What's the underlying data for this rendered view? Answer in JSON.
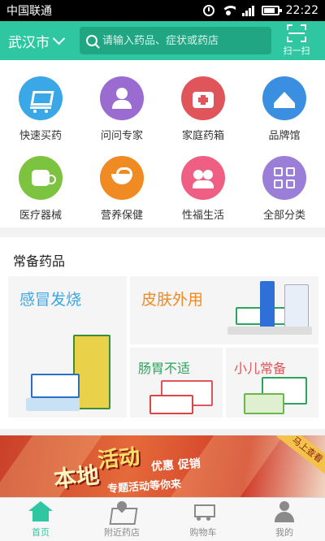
{
  "status_bar": {
    "carrier": "中国联通",
    "time": "22:22"
  },
  "header": {
    "city": "武汉市",
    "search_placeholder": "请输入药品、症状或药店",
    "scan_label": "扫一扫"
  },
  "categories": [
    {
      "label": "快速买药",
      "icon": "cart-icon",
      "color": "#3aa7e6"
    },
    {
      "label": "问问专家",
      "icon": "doctor-icon",
      "color": "#9a6cd1"
    },
    {
      "label": "家庭药箱",
      "icon": "medkit-icon",
      "color": "#e0555a"
    },
    {
      "label": "品牌馆",
      "icon": "crown-icon",
      "color": "#3a8fe0"
    },
    {
      "label": "医疗器械",
      "icon": "device-icon",
      "color": "#7cc43f"
    },
    {
      "label": "营养保健",
      "icon": "bowl-icon",
      "color": "#f08a22"
    },
    {
      "label": "性福生活",
      "icon": "couple-icon",
      "color": "#ef5f83"
    },
    {
      "label": "全部分类",
      "icon": "grid-icon",
      "color": "#9a7ed8"
    }
  ],
  "medicines": {
    "title": "常备药品",
    "tiles": [
      {
        "label": "感冒发烧",
        "color": "#3aa7e6"
      },
      {
        "label": "皮肤外用",
        "color": "#f08a22"
      },
      {
        "label": "肠胃不适",
        "color": "#2aa55a"
      },
      {
        "label": "小儿常备",
        "color": "#e0555a"
      }
    ]
  },
  "banner": {
    "word_local": "本地",
    "word_activity": "活动",
    "word_deals": "优惠  促销",
    "word_topics": "专题活动等你来",
    "corner": "马上查看"
  },
  "tabs": [
    {
      "label": "首页",
      "icon": "home-icon",
      "active": true
    },
    {
      "label": "附近药店",
      "icon": "map-icon",
      "active": false
    },
    {
      "label": "购物车",
      "icon": "cart-icon",
      "active": false
    },
    {
      "label": "我的",
      "icon": "user-icon",
      "active": false
    }
  ],
  "colors": {
    "brand": "#2fc7a2",
    "tab_active": "#2fc7a2",
    "tab_inactive": "#8a8a8a"
  }
}
